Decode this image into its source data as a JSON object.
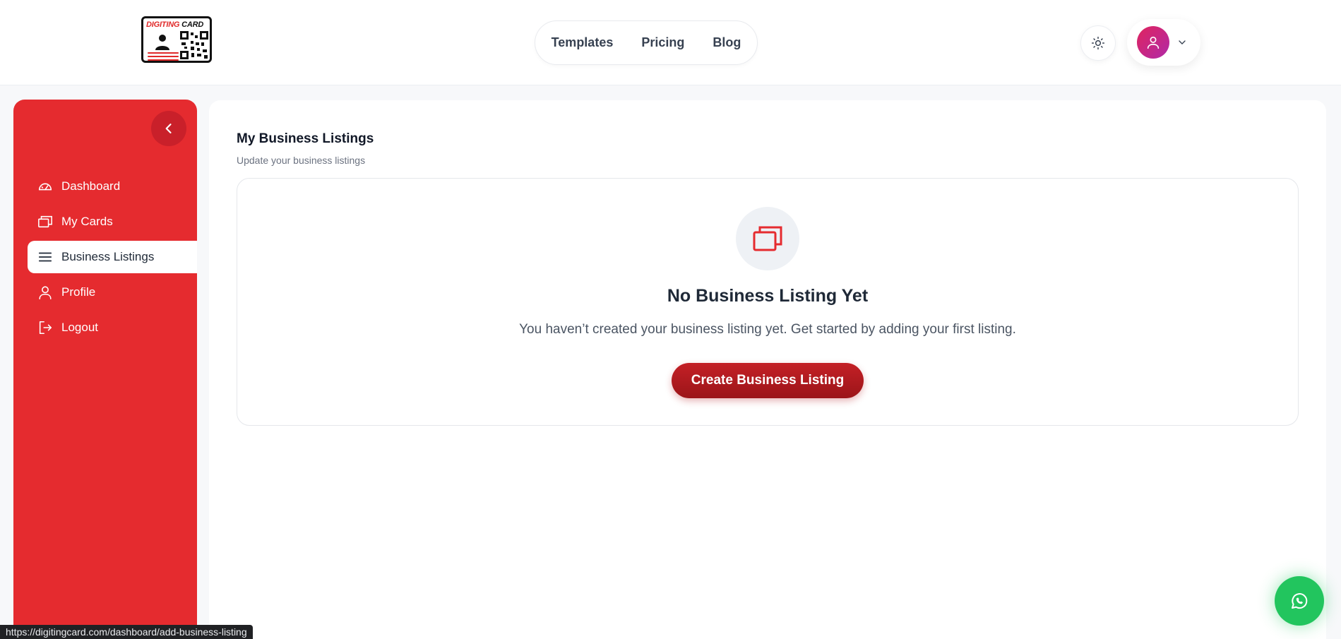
{
  "header": {
    "logo": {
      "word1": "DIGITING",
      "word2": "CARD"
    },
    "nav": [
      {
        "label": "Templates"
      },
      {
        "label": "Pricing"
      },
      {
        "label": "Blog"
      }
    ],
    "theme_icon": "sun-icon",
    "user_icon": "user-icon",
    "dropdown_icon": "chevron-down-icon"
  },
  "sidebar": {
    "collapse_icon": "chevron-left-icon",
    "items": [
      {
        "label": "Dashboard",
        "icon": "gauge-icon",
        "active": false
      },
      {
        "label": "My Cards",
        "icon": "cards-icon",
        "active": false
      },
      {
        "label": "Business Listings",
        "icon": "menu-lines-icon",
        "active": true
      },
      {
        "label": "Profile",
        "icon": "user-icon",
        "active": false
      },
      {
        "label": "Logout",
        "icon": "logout-icon",
        "active": false
      }
    ]
  },
  "main": {
    "title": "My Business Listings",
    "subtitle": "Update your business listings",
    "empty_state": {
      "icon": "cards-icon",
      "title": "No Business Listing Yet",
      "description": "You haven’t created your business listing yet. Get started by adding your first listing.",
      "button_label": "Create Business Listing"
    }
  },
  "whatsapp_icon": "whatsapp-icon",
  "status_bar": {
    "url": "https://digitingcard.com/dashboard/add-business-listing"
  },
  "colors": {
    "brand_red": "#e52b2f",
    "button_red": "#b01b20",
    "whatsapp_green": "#22c55e"
  }
}
